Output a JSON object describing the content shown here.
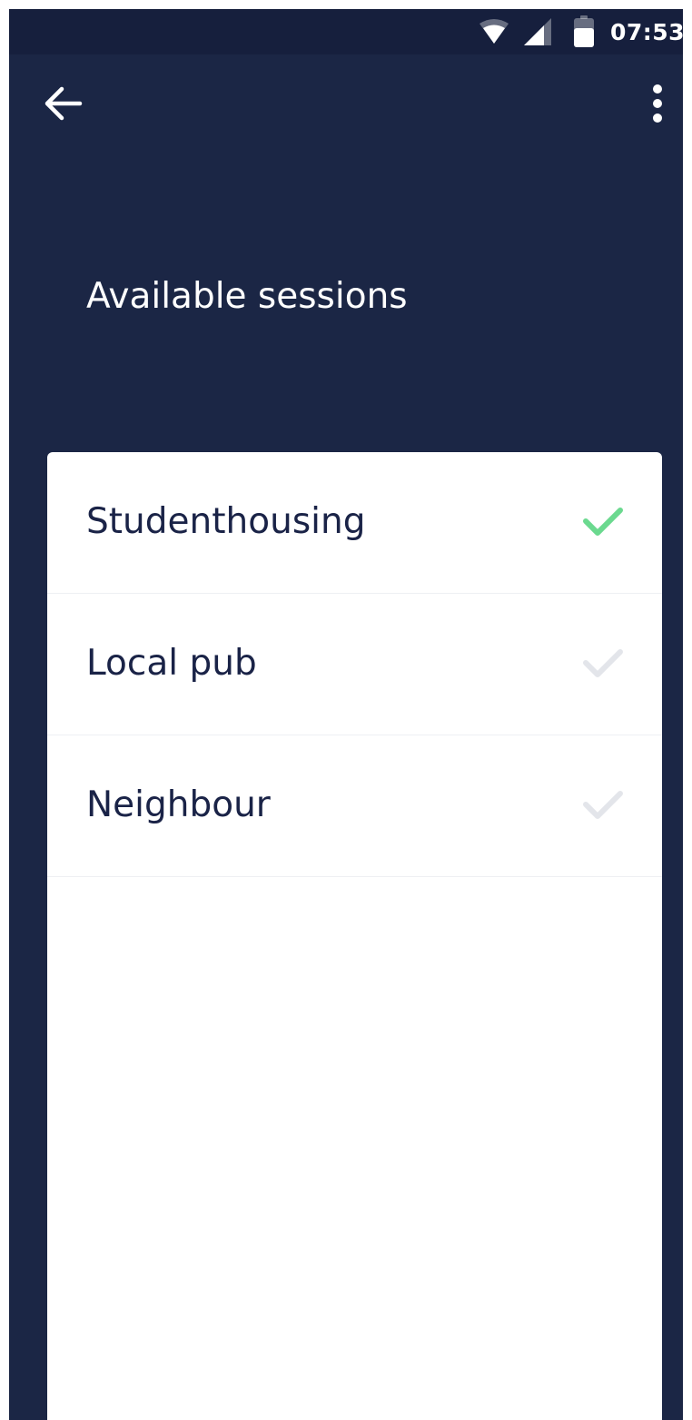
{
  "status_bar": {
    "time": "07:53",
    "icons": [
      "wifi-icon",
      "cell-signal-icon",
      "battery-icon"
    ]
  },
  "app_bar": {
    "back_icon": "arrow-left-icon",
    "menu_icon": "more-vertical-icon"
  },
  "page": {
    "title": "Available sessions"
  },
  "sessions": [
    {
      "label": "Studenthousing",
      "selected": true
    },
    {
      "label": "Local pub",
      "selected": false
    },
    {
      "label": "Neighbour",
      "selected": false
    }
  ],
  "colors": {
    "background": "#1b2645",
    "status_bar": "#161f3d",
    "check_selected": "#6bd98f",
    "check_unselected": "#e3e5ea",
    "text_dark": "#1a2347"
  }
}
